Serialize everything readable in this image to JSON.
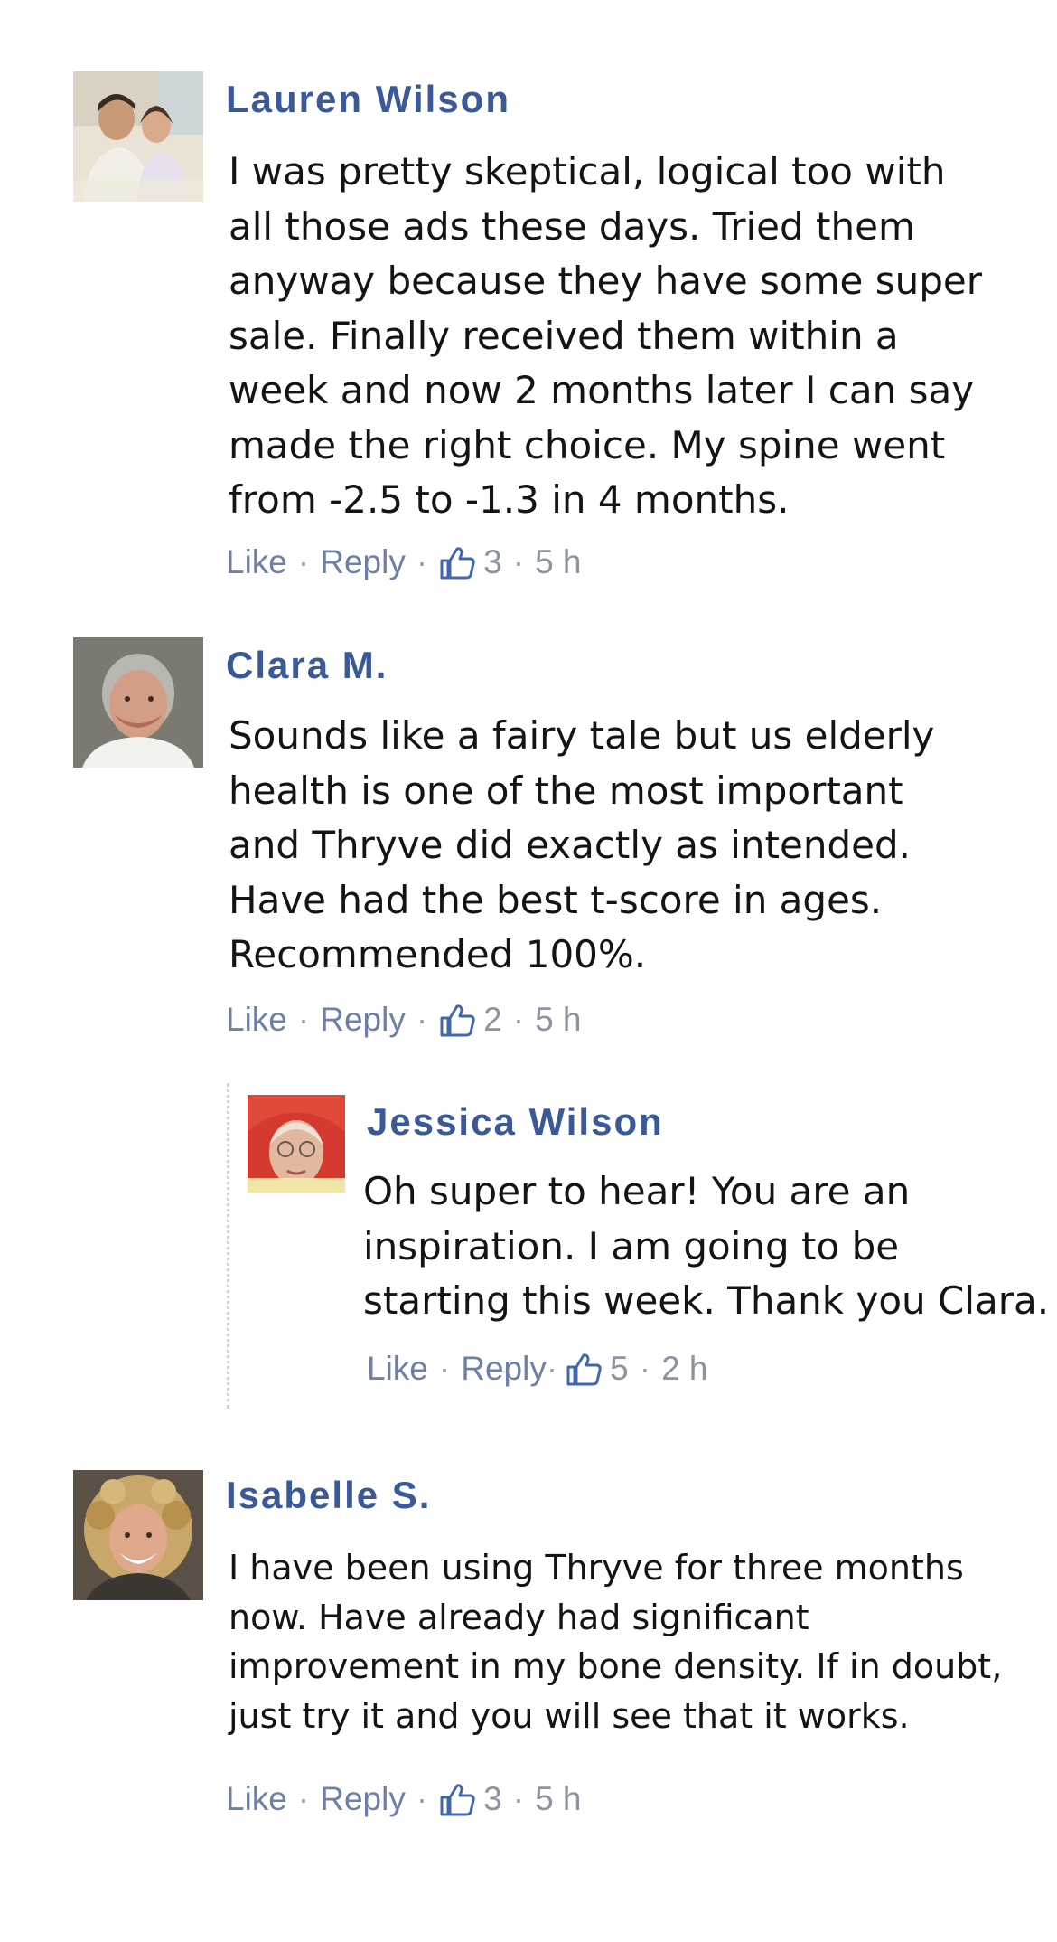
{
  "comments": [
    {
      "name": "Lauren Wilson",
      "text": "I was pretty skeptical, logical too with\nall those ads these days. Tried them\nanyway because they have some super\nsale. Finally received them within a\nweek and now 2 months later I can say\nmade the right choice. My spine went\nfrom -2.5 to -1.3 in 4 months.",
      "like_label": "Like",
      "reply_label": "Reply",
      "likes": "3",
      "time": "5 h"
    },
    {
      "name": "Clara M.",
      "text": "Sounds like a fairy tale but us elderly\nhealth is one of the most important\nand Thryve did exactly as intended.\nHave had the best t-score in ages.\nRecommended 100%.",
      "like_label": "Like",
      "reply_label": "Reply",
      "likes": "2",
      "time": "5 h"
    },
    {
      "name": "Jessica Wilson",
      "text": "Oh super to hear! You are an\ninspiration. I am going to be\nstarting this week. Thank you Clara.",
      "like_label": "Like",
      "reply_label": "Reply",
      "likes": "5",
      "time": "2 h"
    },
    {
      "name": "Isabelle S.",
      "text": "I have been using Thryve for three months\nnow. Have already had significant\nimprovement in my bone density. If in doubt,\njust try it and you will see that it works.",
      "like_label": "Like",
      "reply_label": "Reply",
      "likes": "3",
      "time": "5 h"
    }
  ],
  "colors": {
    "name": "#3b5998",
    "action_link": "#6f80a8",
    "meta": "#8d93a0",
    "body_text": "#141414",
    "thumb_icon": "#4267b2"
  },
  "icons": {
    "like_count": "thumbs-up-icon"
  }
}
